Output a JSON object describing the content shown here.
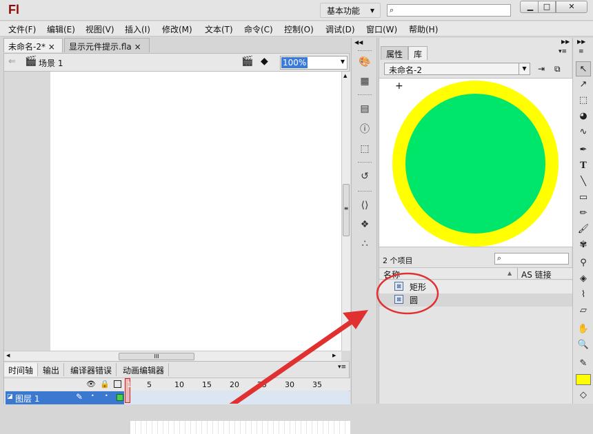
{
  "app": {
    "logo": "Fl",
    "workspace": "基本功能",
    "search_placeholder": ""
  },
  "menu": [
    "文件(F)",
    "编辑(E)",
    "视图(V)",
    "插入(I)",
    "修改(M)",
    "文本(T)",
    "命令(C)",
    "控制(O)",
    "调试(D)",
    "窗口(W)",
    "帮助(H)"
  ],
  "doc_tabs": [
    {
      "label": "未命名-2*",
      "close": "×"
    },
    {
      "label": "显示元件提示.fla",
      "close": "×"
    }
  ],
  "stage": {
    "scene": "场景 1",
    "zoom": "100%",
    "hscroll_thumb": "III",
    "vscroll_thumb": "≡"
  },
  "timeline": {
    "tabs": [
      "时间轴",
      "输出",
      "编译器错误",
      "动画编辑器"
    ],
    "frame_numbers": [
      "1",
      "5",
      "10",
      "15",
      "20",
      "25",
      "30",
      "35"
    ],
    "layer": "图层 1"
  },
  "panel": {
    "tabs": [
      "属性",
      "库"
    ],
    "library_doc": "未命名-2",
    "item_count": "2 个项目",
    "col_name": "名称",
    "col_link": "AS 链接",
    "items": [
      {
        "name": "矩形"
      },
      {
        "name": "圆"
      }
    ],
    "preview_cross": "+"
  },
  "colors": {
    "circle_fill": "#00e66b",
    "circle_stroke": "#ffff00",
    "annotation": "#e03030",
    "fill_swatch": "#ffff00",
    "selection": "#3b78d0"
  }
}
